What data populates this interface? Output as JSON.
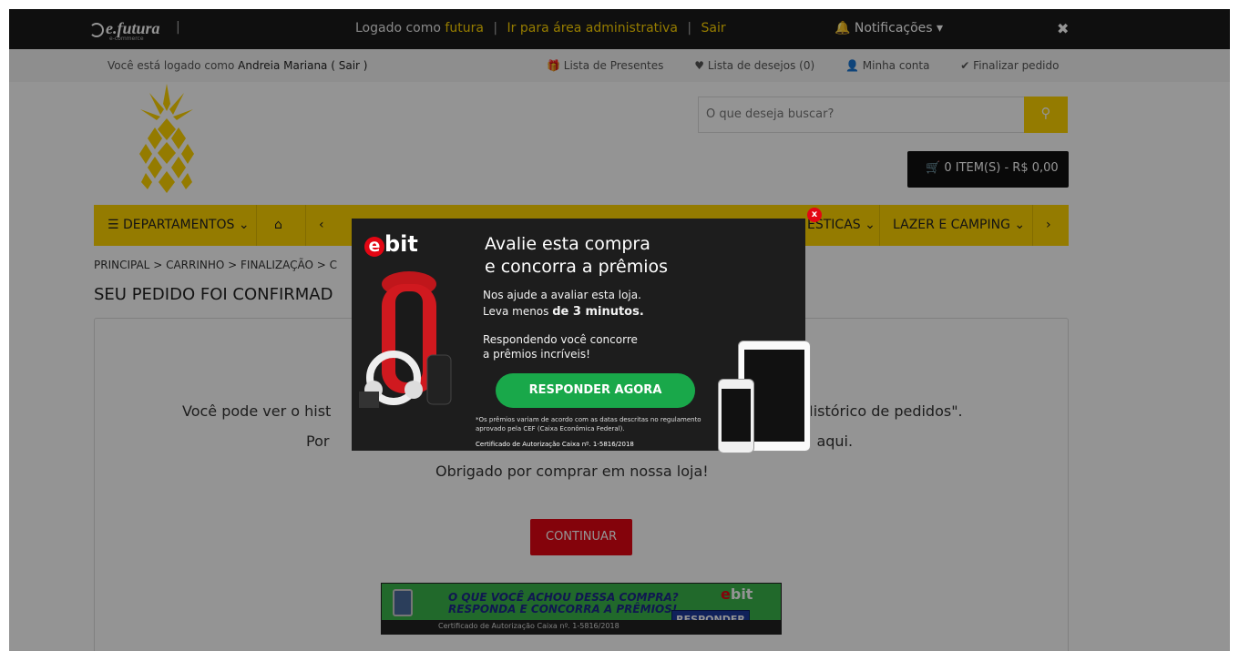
{
  "adminbar": {
    "logo": "e.futura",
    "logo_sub": "e-commerce",
    "logged_as_prefix": "Logado como",
    "logged_as_user": "futura",
    "admin_link": "Ir para área administrativa",
    "logout": "Sair",
    "notifications": "Notificações",
    "close": "✖"
  },
  "userbar": {
    "who_prefix": "Você está logado como",
    "who_name": "Andreia Mariana ( Sair )",
    "links": [
      "Lista de Presentes",
      "Lista de desejos (0)",
      "Minha conta",
      "Finalizar pedido"
    ]
  },
  "search": {
    "placeholder": "O que deseja buscar?"
  },
  "cart": {
    "label": "0 ITEM(S) - R$ 0,00"
  },
  "nav": {
    "departments": "DEPARTAMENTOS",
    "partial_item": "ÉSTICAS",
    "lazer": "LAZER E CAMPING",
    "prev": "‹",
    "next": "›"
  },
  "breadcrumb": [
    "PRINCIPAL",
    "CARRINHO",
    "FINALIZAÇÃO",
    "C"
  ],
  "page_title": "SEU PEDIDO FOI CONFIRMAD",
  "content": {
    "line1_start": "Você pode ver o hist",
    "line1_end": "\"Histórico de pedidos\".",
    "line2_start": "Por",
    "line2_end": "aqui.",
    "line3": "Obrigado por comprar em nossa loja!",
    "continue_button": "CONTINUAR"
  },
  "banner": {
    "headline1": "O QUE VOCÊ ACHOU DESSA COMPRA?",
    "headline2": "RESPONDA E CONCORRA A PRÊMIOS!",
    "cert": "Certificado de Autorização Caixa nº. 1-5816/2018",
    "button": "RESPONDER",
    "brand": "bit"
  },
  "popup": {
    "brand": "bit",
    "title1": "Avalie esta compra",
    "title2": "e concorra a prêmios",
    "help1": "Nos ajude a avaliar esta loja.",
    "help2_prefix": "Leva menos",
    "help2_bold": "de 3 minutos.",
    "resp1": "Respondendo você concorre",
    "resp2": "a prêmios incríveis!",
    "button": "RESPONDER AGORA",
    "fine": "*Os prêmios variam de acordo com as datas descritas no regulamento aprovado pela CEF (Caixa Econômica Federal).",
    "cert": "Certificado de Autorização Caixa nº. 1-5816/2018",
    "close": "x"
  },
  "colors": {
    "accent": "#ffd400",
    "danger": "#e30613",
    "ebit_green": "#19a84a"
  }
}
